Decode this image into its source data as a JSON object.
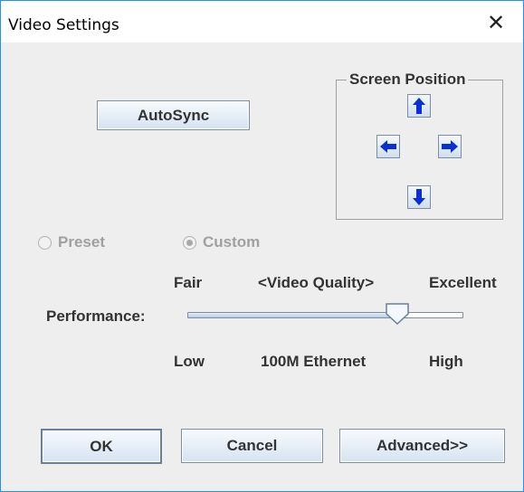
{
  "window": {
    "title": "Video Settings",
    "close_glyph": "✕"
  },
  "buttons": {
    "autosync": "AutoSync",
    "ok": "OK",
    "cancel": "Cancel",
    "advanced": "Advanced>>"
  },
  "screen_position": {
    "title": "Screen Position",
    "icons": [
      "arrow-up-icon",
      "arrow-left-icon",
      "arrow-right-icon",
      "arrow-down-icon"
    ]
  },
  "mode": {
    "options": [
      {
        "label": "Preset",
        "checked": false,
        "enabled": false
      },
      {
        "label": "Custom",
        "checked": true,
        "enabled": false
      }
    ]
  },
  "quality": {
    "top_labels": [
      "Fair",
      "<Video Quality>",
      "Excellent"
    ],
    "slider_label": "Performance:",
    "bottom_labels": [
      "Low",
      "100M Ethernet",
      "High"
    ],
    "slider_value_fraction": 0.76
  },
  "colors": {
    "arrow_blue": "#0a2fd6",
    "window_border": "#1e90ff",
    "disabled_text": "#a0a0a0"
  }
}
